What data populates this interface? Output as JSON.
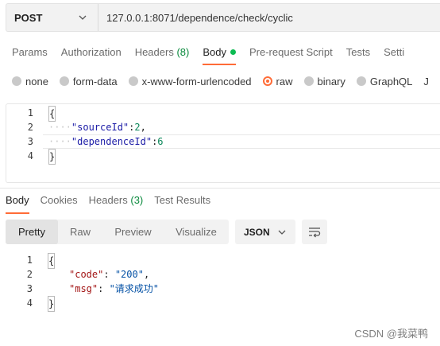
{
  "request": {
    "method": "POST",
    "url": "127.0.0.1:8071/dependence/check/cyclic"
  },
  "request_tabs": [
    {
      "label": "Params"
    },
    {
      "label": "Authorization"
    },
    {
      "label": "Headers",
      "count": "(8)"
    },
    {
      "label": "Body"
    },
    {
      "label": "Pre-request Script"
    },
    {
      "label": "Tests"
    },
    {
      "label": "Setti"
    }
  ],
  "body_types": [
    "none",
    "form-data",
    "x-www-form-urlencoded",
    "raw",
    "binary",
    "GraphQL",
    "J"
  ],
  "body_type_selected": "raw",
  "request_body": {
    "line_numbers": [
      "1",
      "2",
      "3",
      "4"
    ],
    "open_brace": "{",
    "close_brace": "}",
    "indent": "····",
    "line2_key": "\"sourceId\"",
    "line2_sep": ":",
    "line2_val": "2",
    "line2_end": ",",
    "line3_key": "\"dependenceId\"",
    "line3_sep": ":",
    "line3_val": "6"
  },
  "response_tabs": [
    {
      "label": "Body"
    },
    {
      "label": "Cookies"
    },
    {
      "label": "Headers",
      "count": "(3)"
    },
    {
      "label": "Test Results"
    }
  ],
  "view_modes": [
    "Pretty",
    "Raw",
    "Preview",
    "Visualize"
  ],
  "format": "JSON",
  "response_body": {
    "line_numbers": [
      "1",
      "2",
      "3",
      "4"
    ],
    "open_brace": "{",
    "close_brace": "}",
    "line2_key": "\"code\"",
    "line2_sep": ": ",
    "line2_val": "\"200\"",
    "line2_end": ",",
    "line3_key": "\"msg\"",
    "line3_sep": ": ",
    "line3_val": "\"请求成功\""
  },
  "watermark": "CSDN @我菜鸭",
  "colors": {
    "accent": "#ff6c37",
    "status_dot": "#0cbb52",
    "count": "#0b8a3e"
  }
}
